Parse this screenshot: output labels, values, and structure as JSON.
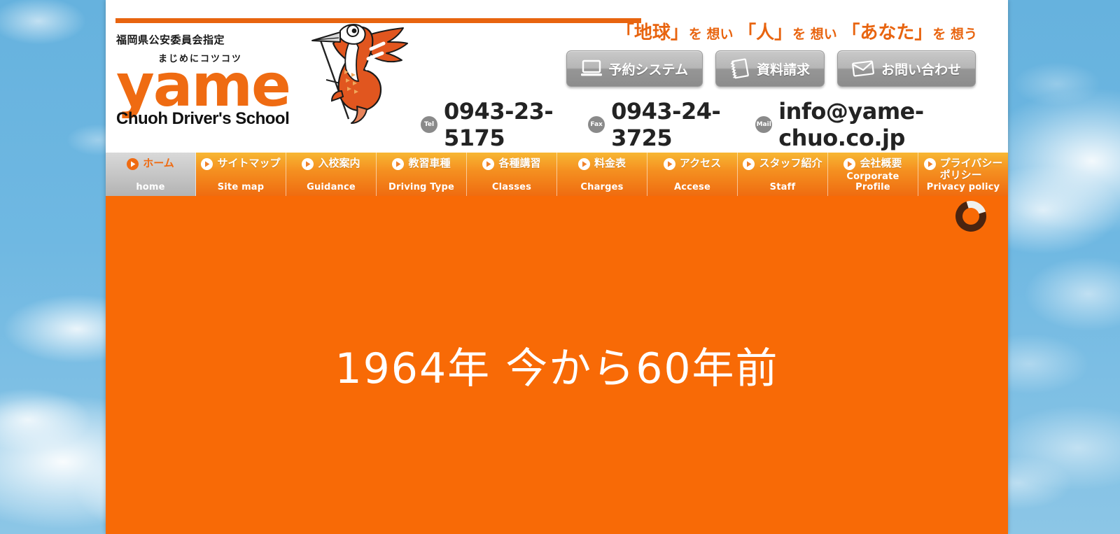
{
  "site": {
    "certification": "福岡県公安委員会指定",
    "slogan_small": "まじめにコツコツ",
    "logo_main": "yame",
    "logo_sub": "Chuoh Driver's School",
    "tagline_full": "「地球」を想い「人」を想い「あなた」を想う",
    "tagline_parts": {
      "a": "「地球」",
      "b": "を 想い ",
      "c": "「人」",
      "d": "を 想い ",
      "e": "「あなた」",
      "f": "を 想う"
    },
    "accent_color": "#ef6b12",
    "stage_color": "#f86a06",
    "sky_color": "#6cb5e0"
  },
  "header_buttons": [
    {
      "label": "予約システム",
      "icon": "monitor-icon"
    },
    {
      "label": "資料請求",
      "icon": "notebook-icon"
    },
    {
      "label": "お問い合わせ",
      "icon": "envelope-icon"
    }
  ],
  "contact": {
    "tel_badge": "Tel",
    "tel": "0943-23-5175",
    "fax_badge": "Fax",
    "fax": "0943-24-3725",
    "mail_badge": "Mail",
    "mail": "info@yame-chuo.co.jp"
  },
  "nav": {
    "active_index": 0,
    "items": [
      {
        "jp": "ホーム",
        "en": "home",
        "active": true
      },
      {
        "jp": "サイトマップ",
        "en": "Site map",
        "active": false
      },
      {
        "jp": "入校案内",
        "en": "Guidance",
        "active": false
      },
      {
        "jp": "教習車種",
        "en": "Driving Type",
        "active": false
      },
      {
        "jp": "各種講習",
        "en": "Classes",
        "active": false
      },
      {
        "jp": "料金表",
        "en": "Charges",
        "active": false
      },
      {
        "jp": "アクセス",
        "en": "Accese",
        "active": false
      },
      {
        "jp": "スタッフ紹介",
        "en": "Staff",
        "active": false
      },
      {
        "jp": "会社概要",
        "en": "Corporate Profile",
        "active": false
      },
      {
        "jp": "プライバシー\nポリシー",
        "en": "Privacy policy",
        "active": false
      }
    ]
  },
  "stage": {
    "slide_text": "1964年  今から60年前",
    "loading_indicator": "loading-spinner"
  }
}
